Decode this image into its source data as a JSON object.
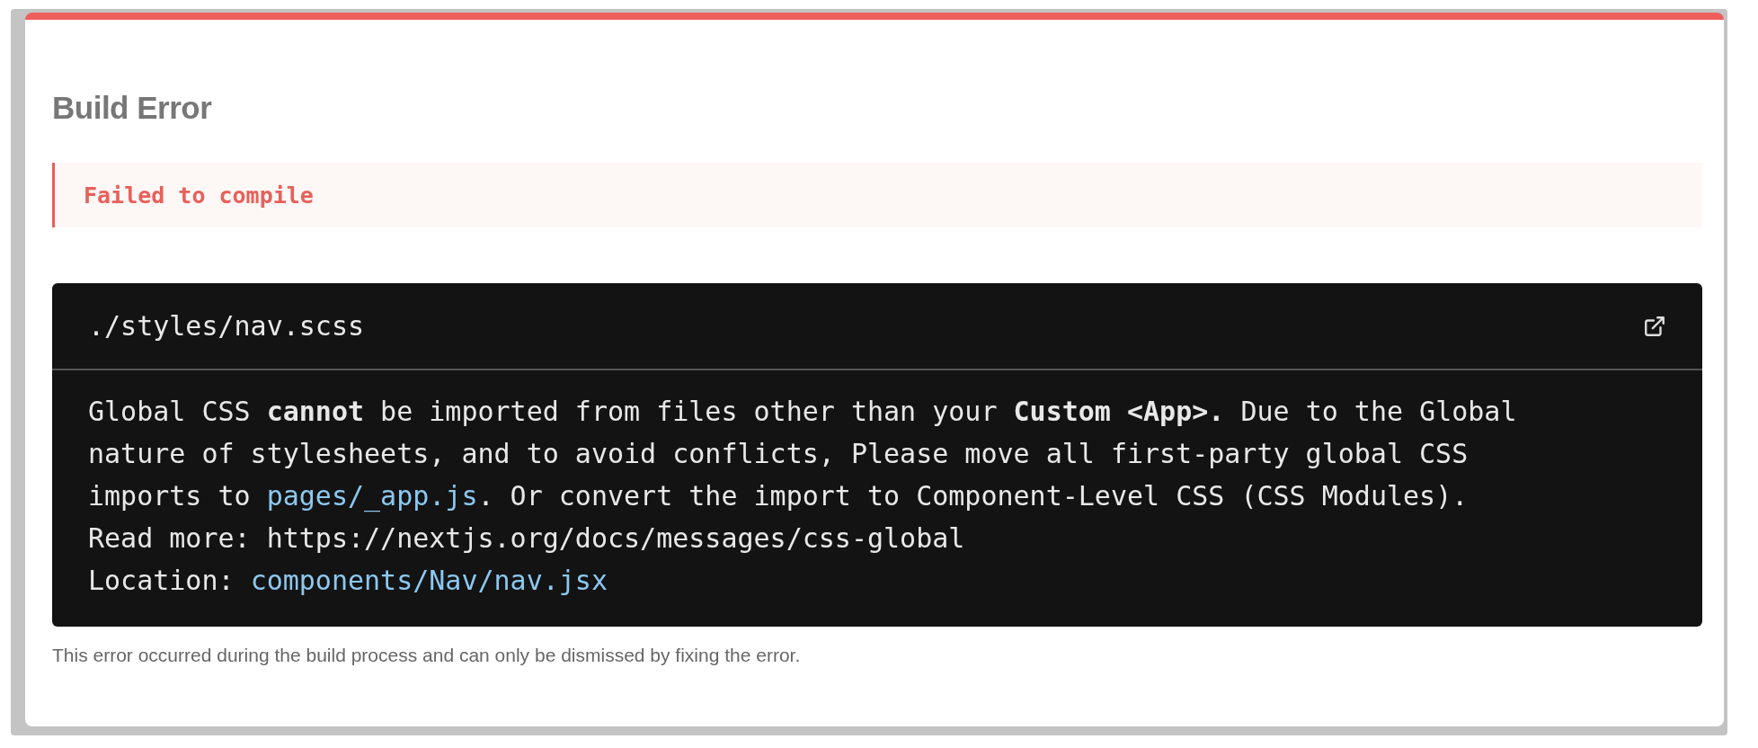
{
  "title": "Build Error",
  "alert": {
    "text": "Failed to compile"
  },
  "code_frame": {
    "file": "./styles/nav.scss",
    "message": [
      {
        "kind": "text",
        "text": "Global CSS "
      },
      {
        "kind": "bold",
        "text": "cannot"
      },
      {
        "kind": "text",
        "text": " be imported from files other than your "
      },
      {
        "kind": "bold",
        "text": "Custom <App>."
      },
      {
        "kind": "text",
        "text": " Due to the Global nature of stylesheets, and to avoid conflicts, Please move all first-party global CSS imports to "
      },
      {
        "kind": "link",
        "text": "pages/_app.js"
      },
      {
        "kind": "text",
        "text": ". Or convert the import to Component-Level CSS (CSS Modules)."
      }
    ],
    "read_more": "Read more: https://nextjs.org/docs/messages/css-global",
    "location_label": "Location:",
    "location_link": "components/Nav/nav.jsx"
  },
  "footer": "This error occurred during the build process and can only be dismissed by fixing the error."
}
